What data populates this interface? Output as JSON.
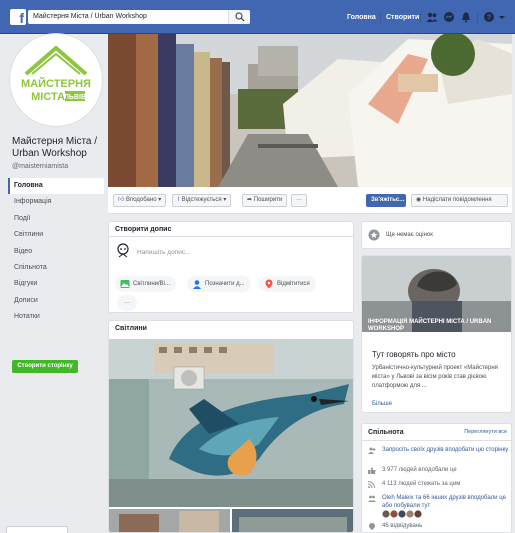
{
  "topbar": {
    "logo": "f",
    "search_value": "Майстерня Міста / Urban Workshop",
    "nav_home": "Головна",
    "nav_create": "Створити",
    "icons": [
      "friends-icon",
      "messenger-icon",
      "notifications-icon",
      "help-icon",
      "dropdown-icon"
    ]
  },
  "page": {
    "name": "Майстерня Міста / Urban Workshop",
    "handle": "@maisterniamista",
    "logo_line1": "МАЙСТЕРНЯ",
    "logo_line2": "МІСТА",
    "logo_city": "ЛЬВІВ"
  },
  "sidebar": {
    "items": [
      {
        "label": "Головна",
        "active": true
      },
      {
        "label": "Інформація"
      },
      {
        "label": "Події"
      },
      {
        "label": "Світлини"
      },
      {
        "label": "Відео"
      },
      {
        "label": "Спільнота"
      },
      {
        "label": "Відгуки"
      },
      {
        "label": "Дописи"
      },
      {
        "label": "Нотатки"
      }
    ],
    "create_page": "Створити сторінку"
  },
  "actions": {
    "like": "Вподобано",
    "follow": "Відстежується",
    "share": "Поширити",
    "more": "···",
    "contact": "Зв'яжітьс...",
    "message": "Надіслати повідомлення"
  },
  "composer": {
    "title": "Створити допис",
    "placeholder": "Напишіть допис...",
    "photo": "Світлини/Ві...",
    "tag": "Позначити д...",
    "checkin": "Відмітитися",
    "more": "···"
  },
  "photos": {
    "title": "Світлини"
  },
  "right": {
    "no_rating": "Ще немає оцінок",
    "info_overlay": "ІНФОРМАЦІЯ МАЙСТЕРНІ МІСТА / URBAN WORKSHOP",
    "talk_title": "Тут говорять про місто",
    "talk_body": "Урбаністично-культурний проект «Майстерня міста» у Львові за вісім років став дієвою платформою для ...",
    "more": "Більше",
    "community_title": "Спільнота",
    "see_all": "Переглянути все",
    "rows": [
      {
        "text": "Запросіть своїх друзів вподобати цю сторінку"
      },
      {
        "text": "3 977 людей вподобали це"
      },
      {
        "text": "4 113 людей стежать за цим"
      },
      {
        "text": "Oleh Maleix та 66 інших друзів вподобали це або побували тут"
      },
      {
        "text": "46 відвідувань"
      }
    ]
  },
  "colors": {
    "facebook_blue": "#4267b2",
    "create_green": "#42b72a",
    "link": "#365899"
  }
}
